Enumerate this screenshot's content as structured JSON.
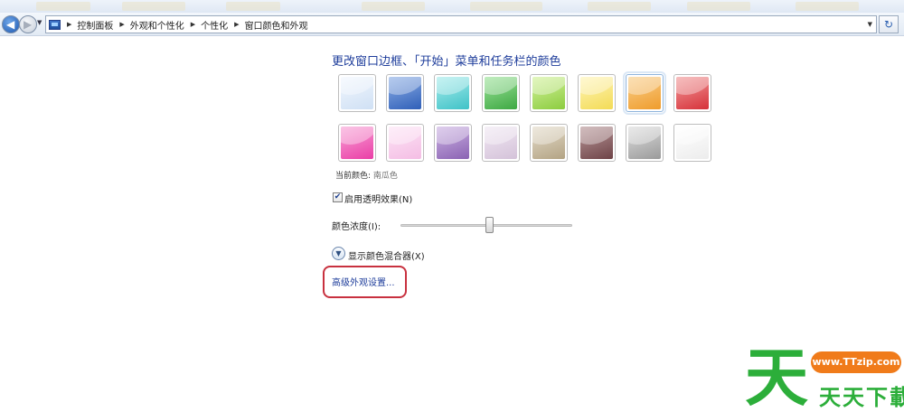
{
  "window": {
    "breadcrumbs": [
      "控制面板",
      "外观和个性化",
      "个性化",
      "窗口颜色和外观"
    ]
  },
  "main": {
    "title": "更改窗口边框、「开始」菜单和任务栏的颜色",
    "swatches": [
      {
        "name": "sky",
        "colors": [
          "#f2f7fe",
          "#cfe0f4"
        ]
      },
      {
        "name": "twilight",
        "colors": [
          "#8fb0e6",
          "#2f5fb8"
        ]
      },
      {
        "name": "sea",
        "colors": [
          "#a8ecec",
          "#3fc2c7"
        ]
      },
      {
        "name": "leaf",
        "colors": [
          "#9de39a",
          "#3ea843"
        ]
      },
      {
        "name": "lime",
        "colors": [
          "#d3f29c",
          "#8ccc3f"
        ]
      },
      {
        "name": "banana",
        "colors": [
          "#fff5b8",
          "#f3db56"
        ]
      },
      {
        "name": "pumpkin",
        "colors": [
          "#f9cf8c",
          "#ef9c2c"
        ]
      },
      {
        "name": "ruby",
        "colors": [
          "#f29b9b",
          "#d6323a"
        ]
      },
      {
        "name": "fuchsia",
        "colors": [
          "#f8a4d7",
          "#ea3ea6"
        ]
      },
      {
        "name": "blush",
        "colors": [
          "#fde5f6",
          "#f4bde4"
        ]
      },
      {
        "name": "violet",
        "colors": [
          "#cdb4e3",
          "#8a62b3"
        ]
      },
      {
        "name": "lavender",
        "colors": [
          "#f1e8f3",
          "#d4c2d9"
        ]
      },
      {
        "name": "taupe",
        "colors": [
          "#e4dccb",
          "#b3a383"
        ]
      },
      {
        "name": "chocolate",
        "colors": [
          "#b9989a",
          "#6e4347"
        ]
      },
      {
        "name": "slate",
        "colors": [
          "#dedede",
          "#9a9a9a"
        ]
      },
      {
        "name": "frost",
        "colors": [
          "#ffffff",
          "#ececec"
        ]
      }
    ],
    "selected_index": 6,
    "current_color_label": "当前颜色:",
    "current_color_value": "南瓜色",
    "transparency_checked": true,
    "transparency_label": "启用透明效果(N)",
    "intensity_label": "颜色浓度(I):",
    "intensity_fraction": 0.52,
    "mixer_label": "显示颜色混合器(X)",
    "advanced_link": "高级外观设置..."
  },
  "watermark": {
    "url": "www.TTzip.com",
    "text": "天天下載",
    "logo_char": "天"
  },
  "colors": {
    "link": "#1e3d9b",
    "highlight": "#c8313f",
    "watermark_green": "#2cae3a",
    "watermark_orange": "#f07b1a"
  }
}
